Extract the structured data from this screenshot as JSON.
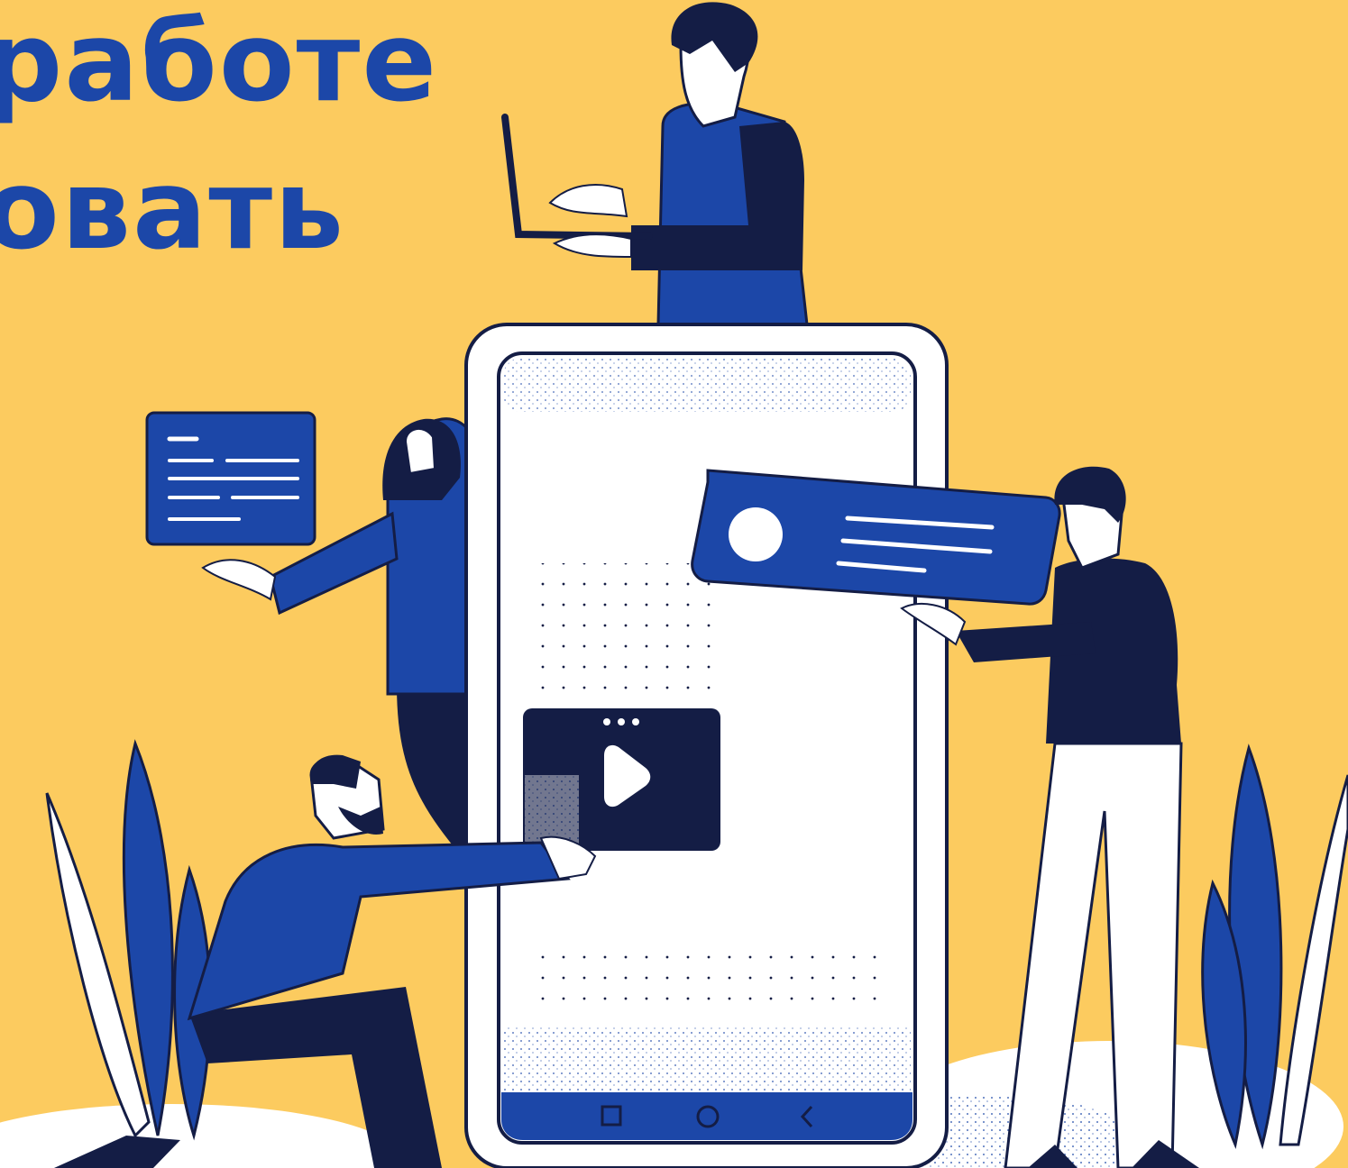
{
  "heading": {
    "line1": "работе",
    "line2": "овать"
  },
  "colors": {
    "background": "#FCCB5F",
    "primary_blue": "#1C47A8",
    "navy": "#141D45",
    "white": "#FFFFFF"
  },
  "icons": {
    "phone_nav": [
      "square-icon",
      "circle-icon",
      "back-chevron-icon"
    ],
    "media": "play-icon",
    "menu": "more-dots-icon"
  }
}
